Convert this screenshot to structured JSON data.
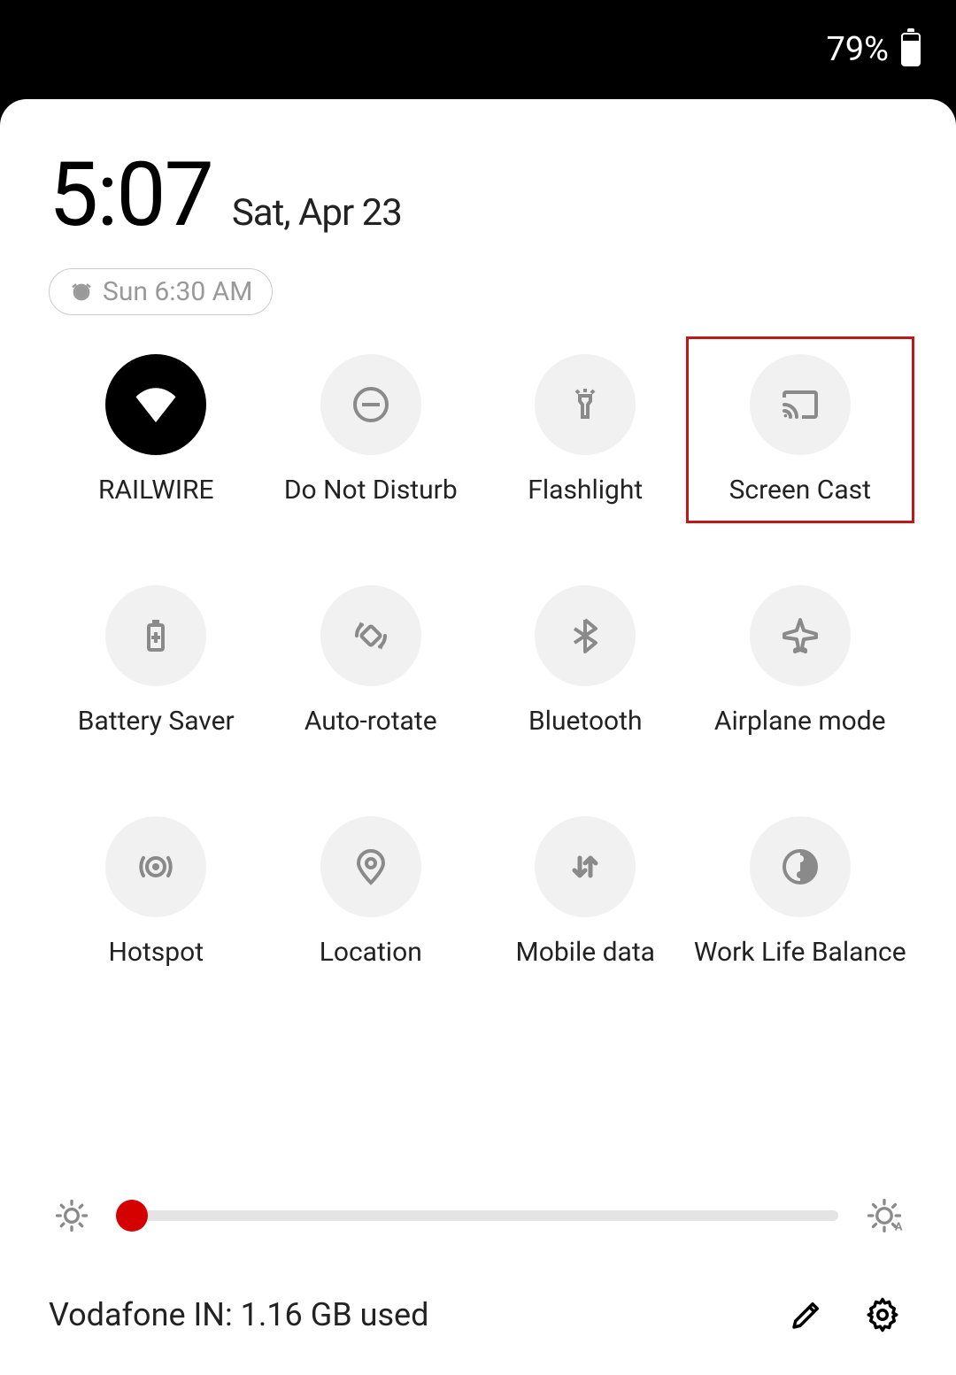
{
  "status": {
    "battery_percent": "79%"
  },
  "header": {
    "time": "5:07",
    "date": "Sat, Apr 23",
    "alarm": "Sun 6:30 AM"
  },
  "tiles": [
    {
      "id": "wifi",
      "label": "RAILWIRE",
      "active": true
    },
    {
      "id": "dnd",
      "label": "Do Not Disturb",
      "active": false
    },
    {
      "id": "flashlight",
      "label": "Flashlight",
      "active": false
    },
    {
      "id": "screen-cast",
      "label": "Screen Cast",
      "active": false,
      "highlighted": true
    },
    {
      "id": "battery-saver",
      "label": "Battery Saver",
      "active": false
    },
    {
      "id": "auto-rotate",
      "label": "Auto-rotate",
      "active": false
    },
    {
      "id": "bluetooth",
      "label": "Bluetooth",
      "active": false
    },
    {
      "id": "airplane",
      "label": "Airplane mode",
      "active": false
    },
    {
      "id": "hotspot",
      "label": "Hotspot",
      "active": false
    },
    {
      "id": "location",
      "label": "Location",
      "active": false
    },
    {
      "id": "mobile-data",
      "label": "Mobile data",
      "active": false
    },
    {
      "id": "work-life",
      "label": "Work Life Balance",
      "active": false
    }
  ],
  "brightness": {
    "value_percent": 4
  },
  "footer": {
    "data_usage": "Vodafone IN: 1.16 GB used"
  },
  "colors": {
    "accent": "#d50000",
    "highlight_box": "#c01818"
  }
}
